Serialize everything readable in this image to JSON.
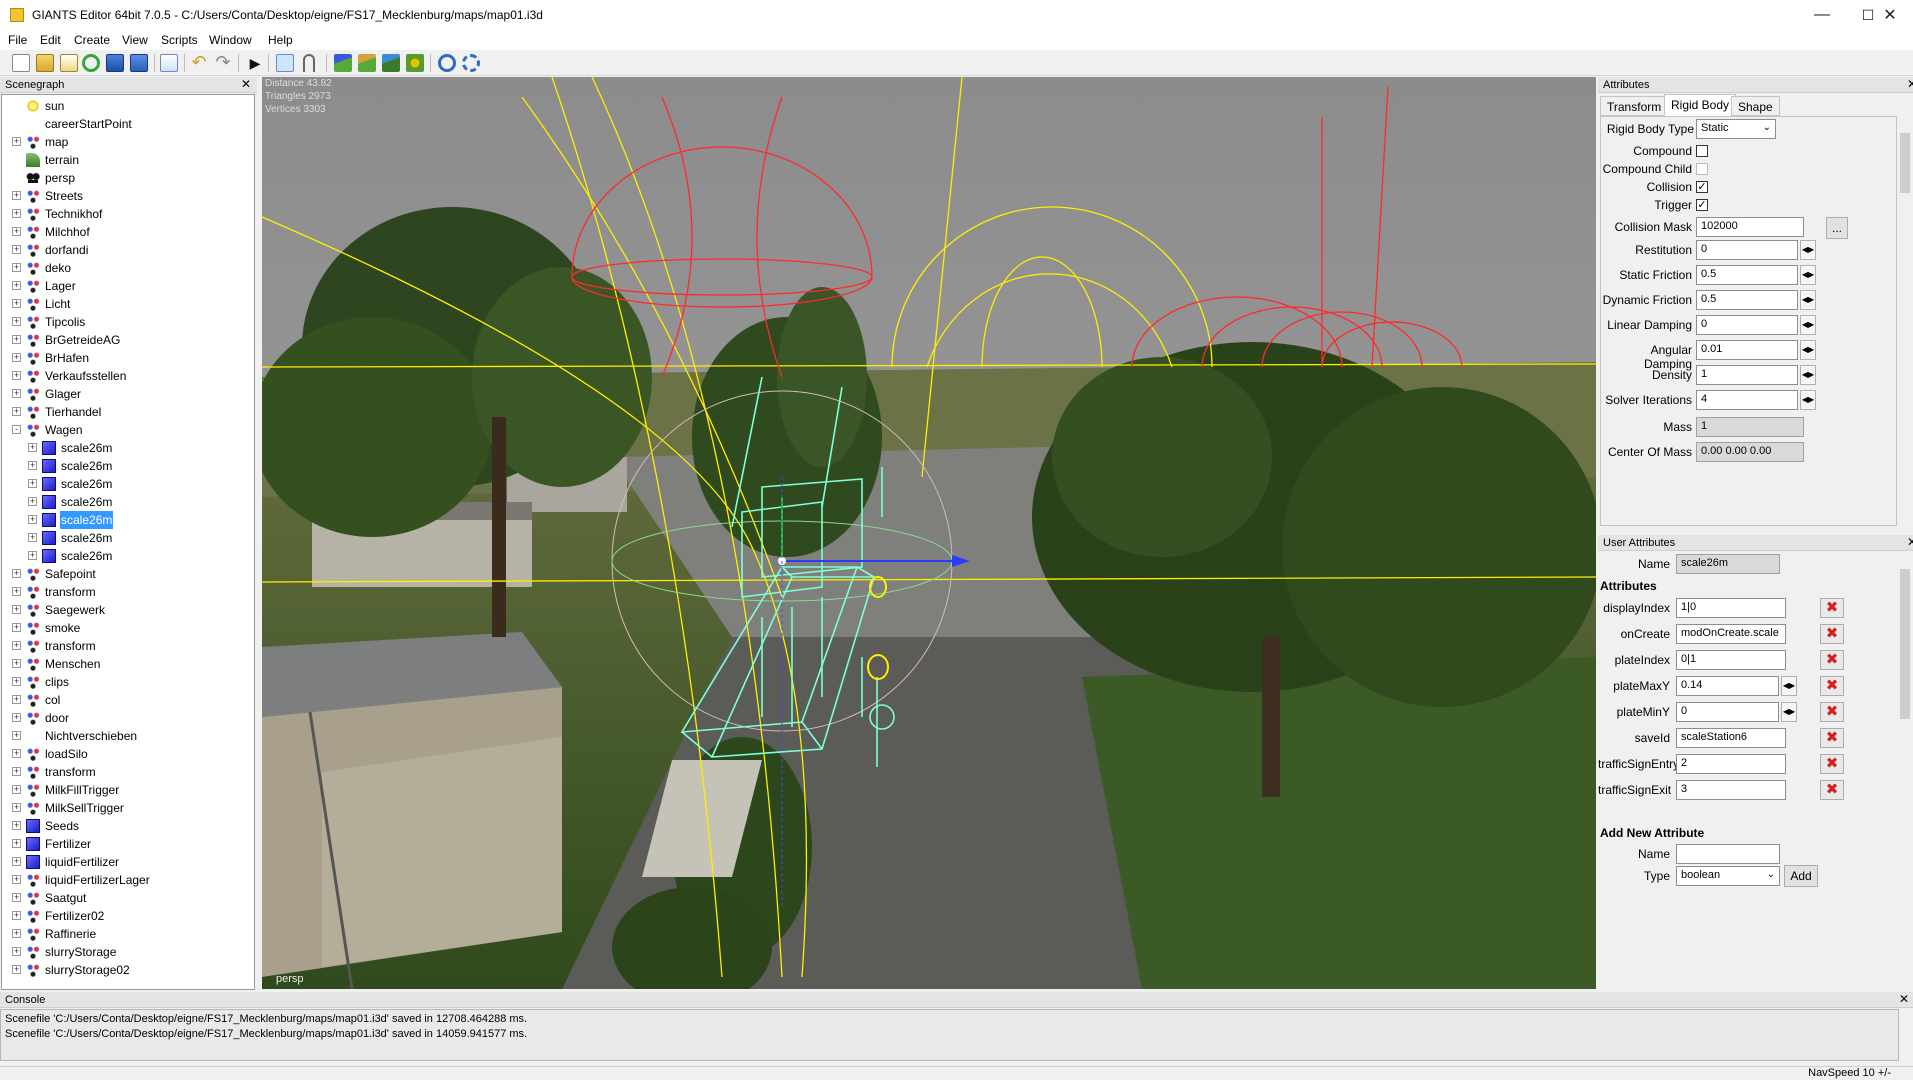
{
  "window": {
    "title": "GIANTS Editor 64bit 7.0.5 - C:/Users/Conta/Desktop/eigne/FS17_Mecklenburg/maps/map01.i3d",
    "minimize": "—",
    "maximize": "☐",
    "close": "✕"
  },
  "menu": [
    "File",
    "Edit",
    "Create",
    "View",
    "Scripts",
    "Window",
    "Help"
  ],
  "toolbar_icons": [
    "new-icon",
    "open-icon",
    "edit-icon",
    "reload-icon",
    "save-icon",
    "save-as-icon",
    "export-icon",
    "undo-icon",
    "redo-icon",
    "play-icon",
    "select-mode-icon",
    "move-mode-icon",
    "terrain-sculpt-icon",
    "terrain-paint-icon",
    "foliage-paint-icon",
    "decal-icon",
    "navigation-icon",
    "camera-icon"
  ],
  "scenegraph": {
    "title": "Scenegraph",
    "close": "✕",
    "nodes": [
      {
        "label": "sun",
        "icon": "light",
        "depth": 0,
        "expander": ""
      },
      {
        "label": "careerStartPoint",
        "icon": "plain",
        "depth": 0,
        "expander": ""
      },
      {
        "label": "map",
        "icon": "transform",
        "depth": 0,
        "expander": "+"
      },
      {
        "label": "terrain",
        "icon": "terrain",
        "depth": 0,
        "expander": ""
      },
      {
        "label": "persp",
        "icon": "camera",
        "depth": 0,
        "expander": ""
      },
      {
        "label": "Streets",
        "icon": "transform",
        "depth": 0,
        "expander": "+"
      },
      {
        "label": "Technikhof",
        "icon": "transform",
        "depth": 0,
        "expander": "+"
      },
      {
        "label": "Milchhof",
        "icon": "transform",
        "depth": 0,
        "expander": "+"
      },
      {
        "label": "dorfandi",
        "icon": "transform",
        "depth": 0,
        "expander": "+"
      },
      {
        "label": "deko",
        "icon": "transform",
        "depth": 0,
        "expander": "+"
      },
      {
        "label": "Lager",
        "icon": "transform",
        "depth": 0,
        "expander": "+"
      },
      {
        "label": "Licht",
        "icon": "transform",
        "depth": 0,
        "expander": "+"
      },
      {
        "label": "Tipcolis",
        "icon": "transform",
        "depth": 0,
        "expander": "+"
      },
      {
        "label": "BrGetreideAG",
        "icon": "transform",
        "depth": 0,
        "expander": "+"
      },
      {
        "label": "BrHafen",
        "icon": "transform",
        "depth": 0,
        "expander": "+"
      },
      {
        "label": "Verkaufsstellen",
        "icon": "transform",
        "depth": 0,
        "expander": "+"
      },
      {
        "label": "Glager",
        "icon": "transform",
        "depth": 0,
        "expander": "+"
      },
      {
        "label": "Tierhandel",
        "icon": "transform",
        "depth": 0,
        "expander": "+"
      },
      {
        "label": "Wagen",
        "icon": "transform",
        "depth": 0,
        "expander": "-"
      },
      {
        "label": "scale26m",
        "icon": "shape",
        "depth": 1,
        "expander": "+"
      },
      {
        "label": "scale26m",
        "icon": "shape",
        "depth": 1,
        "expander": "+"
      },
      {
        "label": "scale26m",
        "icon": "shape",
        "depth": 1,
        "expander": "+"
      },
      {
        "label": "scale26m",
        "icon": "shape",
        "depth": 1,
        "expander": "+"
      },
      {
        "label": "scale26m",
        "icon": "shape",
        "depth": 1,
        "expander": "+",
        "selected": true
      },
      {
        "label": "scale26m",
        "icon": "shape",
        "depth": 1,
        "expander": "+"
      },
      {
        "label": "scale26m",
        "icon": "shape",
        "depth": 1,
        "expander": "+"
      },
      {
        "label": "Safepoint",
        "icon": "transform",
        "depth": 0,
        "expander": "+"
      },
      {
        "label": "transform",
        "icon": "transform",
        "depth": 0,
        "expander": "+"
      },
      {
        "label": "Saegewerk",
        "icon": "transform",
        "depth": 0,
        "expander": "+"
      },
      {
        "label": "smoke",
        "icon": "transform",
        "depth": 0,
        "expander": "+"
      },
      {
        "label": "transform",
        "icon": "transform",
        "depth": 0,
        "expander": "+"
      },
      {
        "label": "Menschen",
        "icon": "transform",
        "depth": 0,
        "expander": "+"
      },
      {
        "label": "clips",
        "icon": "transform",
        "depth": 0,
        "expander": "+"
      },
      {
        "label": "col",
        "icon": "transform",
        "depth": 0,
        "expander": "+"
      },
      {
        "label": "door",
        "icon": "transform",
        "depth": 0,
        "expander": "+"
      },
      {
        "label": "Nichtverschieben",
        "icon": "plain",
        "depth": 0,
        "expander": "+"
      },
      {
        "label": "loadSilo",
        "icon": "transform",
        "depth": 0,
        "expander": "+"
      },
      {
        "label": "transform",
        "icon": "transform",
        "depth": 0,
        "expander": "+"
      },
      {
        "label": "MilkFillTrigger",
        "icon": "transform",
        "depth": 0,
        "expander": "+"
      },
      {
        "label": "MilkSellTrigger",
        "icon": "transform",
        "depth": 0,
        "expander": "+"
      },
      {
        "label": "Seeds",
        "icon": "shape",
        "depth": 0,
        "expander": "+"
      },
      {
        "label": "Fertilizer",
        "icon": "shape",
        "depth": 0,
        "expander": "+"
      },
      {
        "label": "liquidFertilizer",
        "icon": "shape",
        "depth": 0,
        "expander": "+"
      },
      {
        "label": "liquidFertilizerLager",
        "icon": "transform",
        "depth": 0,
        "expander": "+"
      },
      {
        "label": "Saatgut",
        "icon": "transform",
        "depth": 0,
        "expander": "+"
      },
      {
        "label": "Fertilizer02",
        "icon": "transform",
        "depth": 0,
        "expander": "+"
      },
      {
        "label": "Raffinerie",
        "icon": "transform",
        "depth": 0,
        "expander": "+"
      },
      {
        "label": "slurryStorage",
        "icon": "transform",
        "depth": 0,
        "expander": "+"
      },
      {
        "label": "slurryStorage02",
        "icon": "transform",
        "depth": 0,
        "expander": "+"
      }
    ]
  },
  "viewport": {
    "distance": "Distance 43.82",
    "triangles": "Triangles 2973",
    "vertices": "Vertices 3303",
    "camera": "persp"
  },
  "attributes": {
    "title": "Attributes",
    "close": "✕",
    "tabs": [
      "Transform",
      "Rigid Body",
      "Shape"
    ],
    "active_tab": "Rigid Body",
    "rigid_body_type_label": "Rigid Body Type",
    "rigid_body_type_value": "Static",
    "compound_label": "Compound",
    "compound_checked": false,
    "compound_child_label": "Compound Child",
    "compound_child_checked": false,
    "collision_label": "Collision",
    "collision_checked": true,
    "trigger_label": "Trigger",
    "trigger_checked": true,
    "collision_mask_label": "Collision Mask",
    "collision_mask_value": "102000",
    "collision_mask_button": "...",
    "fields": [
      {
        "label": "Restitution",
        "value": "0"
      },
      {
        "label": "Static Friction",
        "value": "0.5"
      },
      {
        "label": "Dynamic Friction",
        "value": "0.5"
      },
      {
        "label": "Linear Damping",
        "value": "0"
      },
      {
        "label": "Angular Damping",
        "value": "0.01"
      },
      {
        "label": "Density",
        "value": "1"
      },
      {
        "label": "Solver Iterations",
        "value": "4"
      }
    ],
    "mass_label": "Mass",
    "mass_value": "1",
    "center_of_mass_label": "Center Of Mass",
    "center_of_mass_value": "0.00 0.00 0.00"
  },
  "user_attributes": {
    "title": "User Attributes",
    "close": "✕",
    "name_label": "Name",
    "name_value": "scale26m",
    "attributes_heading": "Attributes",
    "rows": [
      {
        "label": "displayIndex",
        "value": "1|0"
      },
      {
        "label": "onCreate",
        "value": "modOnCreate.scale"
      },
      {
        "label": "plateIndex",
        "value": "0|1"
      },
      {
        "label": "plateMaxY",
        "value": "0.14"
      },
      {
        "label": "plateMinY",
        "value": "0"
      },
      {
        "label": "saveId",
        "value": "scaleStation6"
      },
      {
        "label": "trafficSignEntry",
        "value": "2"
      },
      {
        "label": "trafficSignExit",
        "value": "3"
      }
    ],
    "delete_glyph": "✖",
    "add_new_heading": "Add New Attribute",
    "new_name_label": "Name",
    "new_name_value": "",
    "new_type_label": "Type",
    "new_type_value": "boolean",
    "add_button": "Add"
  },
  "console": {
    "title": "Console",
    "close": "✕",
    "lines": [
      "Scenefile 'C:/Users/Conta/Desktop/eigne/FS17_Mecklenburg/maps/map01.i3d' saved in 12708.464288 ms.",
      "Scenefile 'C:/Users/Conta/Desktop/eigne/FS17_Mecklenburg/maps/map01.i3d' saved in 14059.941577 ms."
    ]
  },
  "status": {
    "nav_speed": "NavSpeed 10 +/-"
  },
  "colors": {
    "selection": "#3399ff",
    "delete_red": "#d81e1e",
    "trigger_wire": "#7fffd4",
    "light_range": "#ff2a2a",
    "yellow_range": "#ffee00"
  }
}
